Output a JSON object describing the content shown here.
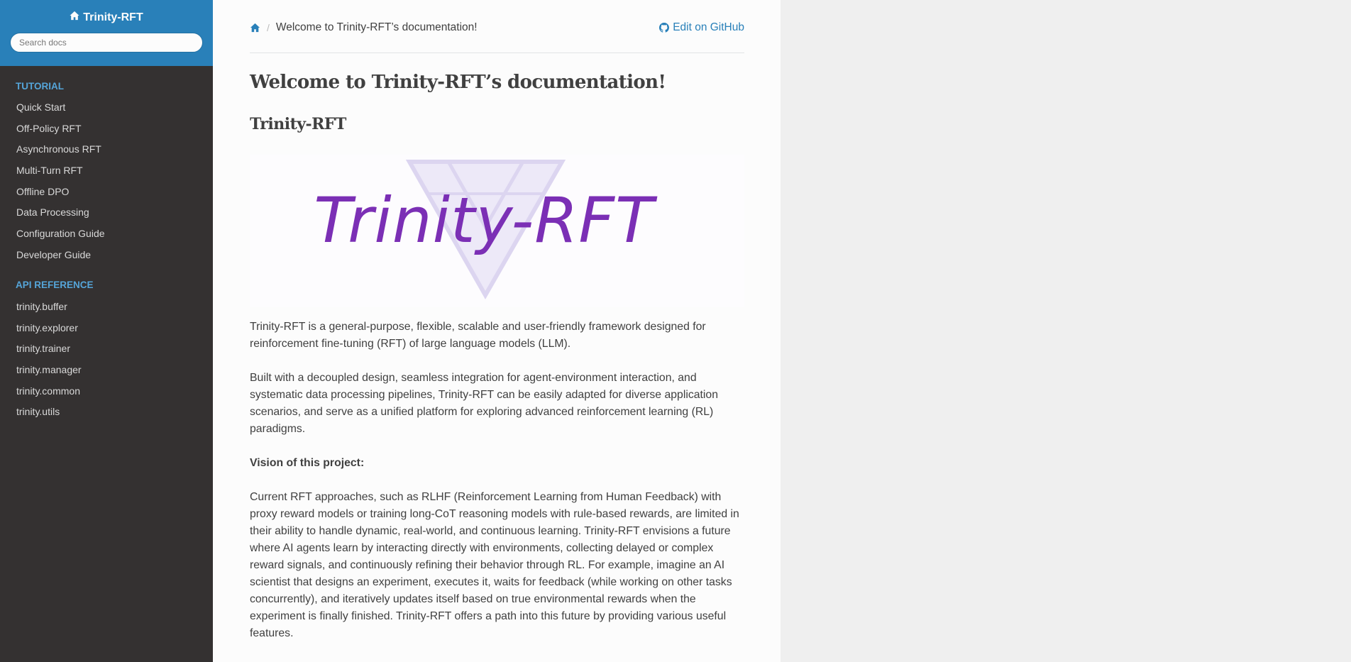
{
  "sidebar": {
    "brand": "Trinity-RFT",
    "search_placeholder": "Search docs",
    "sections": [
      {
        "caption": "TUTORIAL",
        "items": [
          "Quick Start",
          "Off-Policy RFT",
          "Asynchronous RFT",
          "Multi-Turn RFT",
          "Offline DPO",
          "Data Processing",
          "Configuration Guide",
          "Developer Guide"
        ]
      },
      {
        "caption": "API REFERENCE",
        "items": [
          "trinity.buffer",
          "trinity.explorer",
          "trinity.trainer",
          "trinity.manager",
          "trinity.common",
          "trinity.utils"
        ]
      }
    ]
  },
  "breadcrumbs": {
    "current": "Welcome to Trinity-RFT’s documentation!",
    "separator": "/",
    "edit_label": "Edit on GitHub"
  },
  "main": {
    "title": "Welcome to Trinity-RFT’s documentation!",
    "subtitle": "Trinity-RFT",
    "logo_text": "Trinity-RFT",
    "paragraphs": [
      "Trinity-RFT is a general-purpose, flexible, scalable and user-friendly framework designed for reinforcement fine-tuning (RFT) of large language models (LLM).",
      "Built with a decoupled design, seamless integration for agent-environment interaction, and systematic data processing pipelines, Trinity-RFT can be easily adapted for diverse application scenarios, and serve as a unified platform for exploring advanced reinforcement learning (RL) paradigms.",
      "Vision of this project:",
      "Current RFT approaches, such as RLHF (Reinforcement Learning from Human Feedback) with proxy reward models or training long-CoT reasoning models with rule-based rewards, are limited in their ability to handle dynamic, real-world, and continuous learning. Trinity-RFT envisions a future where AI agents learn by interacting directly with environments, collecting delayed or complex reward signals, and continuously refining their behavior through RL. For example, imagine an AI scientist that designs an experiment, executes it, waits for feedback (while working on other tasks concurrently), and iteratively updates itself based on true environmental rewards when the experiment is finally finished. Trinity-RFT offers a path into this future by providing various useful features."
    ]
  },
  "colors": {
    "sidebar_top": "#2980b9",
    "sidebar_bg": "#343131",
    "caption": "#55a5d9",
    "link": "#2980b9",
    "logo_text": "#7b2fb5",
    "logo_triangle": "#d9d2f0"
  },
  "icons": {
    "brand": "home-icon",
    "breadcrumb_home": "home-icon",
    "edit": "github-icon"
  }
}
